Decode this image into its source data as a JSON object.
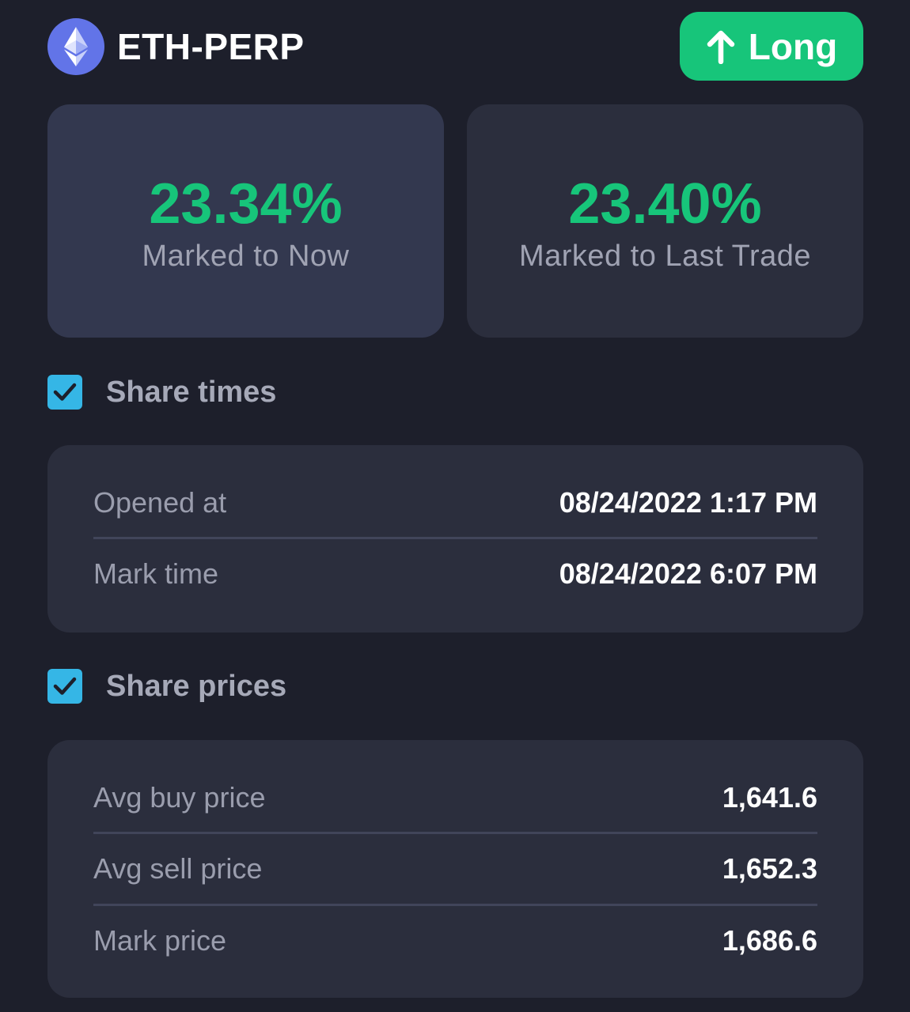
{
  "header": {
    "market": "ETH-PERP",
    "side": "Long",
    "logo_icon": "ethereum-icon",
    "side_icon": "arrow-up-icon"
  },
  "pnl": {
    "now": {
      "value": "23.34%",
      "label": "Marked to Now"
    },
    "last_trade": {
      "value": "23.40%",
      "label": "Marked to Last Trade"
    }
  },
  "options": {
    "share_times": {
      "label": "Share times",
      "checked": true
    },
    "share_prices": {
      "label": "Share prices",
      "checked": true
    }
  },
  "times": {
    "rows": [
      {
        "label": "Opened at",
        "value": "08/24/2022 1:17 PM"
      },
      {
        "label": "Mark time",
        "value": "08/24/2022 6:07 PM"
      }
    ]
  },
  "prices": {
    "rows": [
      {
        "label": "Avg buy price",
        "value": "1,641.6"
      },
      {
        "label": "Avg sell price",
        "value": "1,652.3"
      },
      {
        "label": "Mark price",
        "value": "1,686.6"
      }
    ]
  },
  "colors": {
    "background": "#1d1f2b",
    "card": "#2b2e3d",
    "card_selected": "#33384f",
    "accent_green": "#17c57a",
    "checkbox": "#35b6e6",
    "eth_blue": "#6274e8"
  }
}
